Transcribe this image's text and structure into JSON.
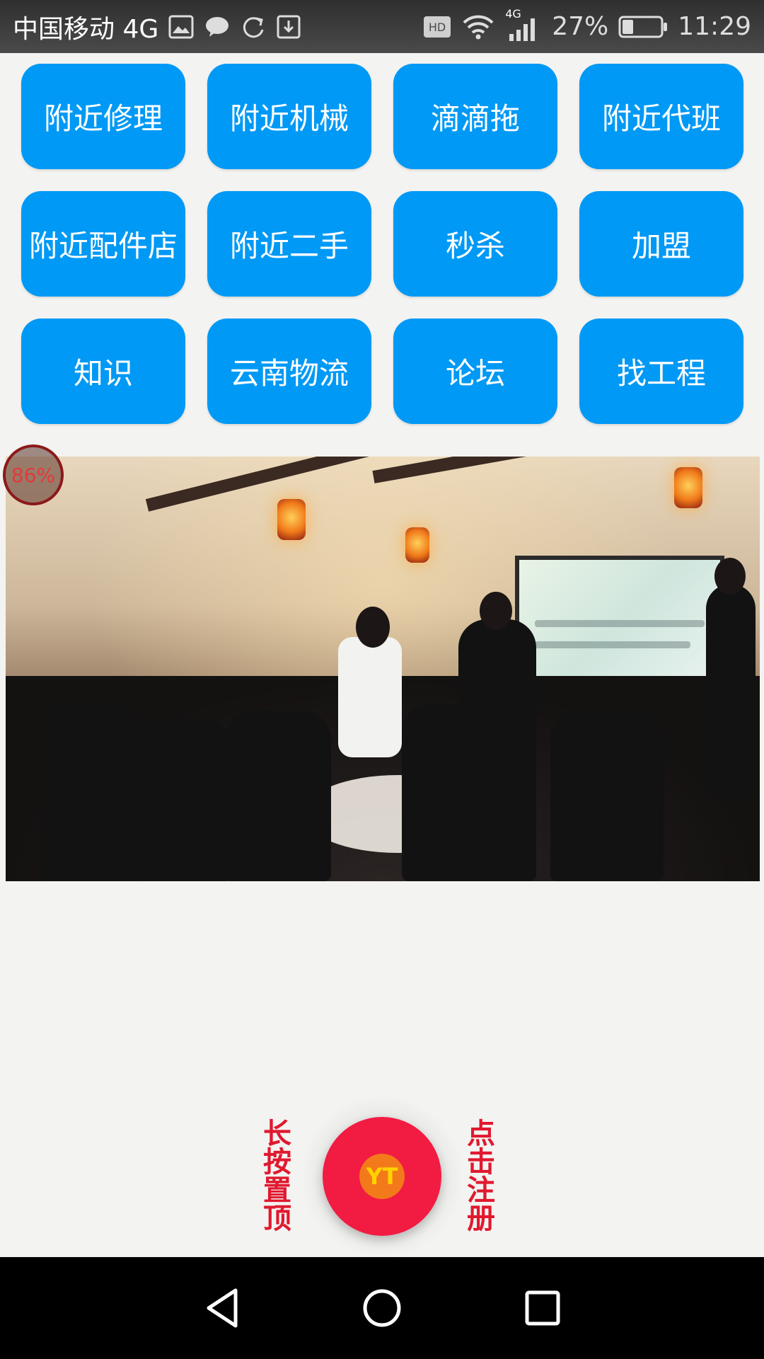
{
  "status_bar": {
    "carrier": "中国移动 4G",
    "network_badge": "4G",
    "battery": "27%",
    "time": "11:29",
    "hd": "HD",
    "icons": [
      "gallery-icon",
      "message-icon",
      "sync-icon",
      "download-icon",
      "hd-icon",
      "wifi-icon",
      "signal-icon",
      "battery-icon"
    ]
  },
  "grid": {
    "items": [
      {
        "label": "附近修理"
      },
      {
        "label": "附近机械"
      },
      {
        "label": "滴滴拖"
      },
      {
        "label": "附近代班"
      },
      {
        "label": "附近配件店"
      },
      {
        "label": "附近二手"
      },
      {
        "label": "秒杀"
      },
      {
        "label": "加盟"
      },
      {
        "label": "知识"
      },
      {
        "label": "云南物流"
      },
      {
        "label": "论坛"
      },
      {
        "label": "找工程"
      }
    ]
  },
  "banner": {
    "progress_badge": "86%"
  },
  "actions": {
    "left_vertical": "长按置顶",
    "right_vertical": "点击注册",
    "fab_logo": "YT"
  },
  "colors": {
    "button_blue": "#0099f5",
    "fab_red": "#f21b42",
    "vertical_text_red": "#e0192f"
  }
}
